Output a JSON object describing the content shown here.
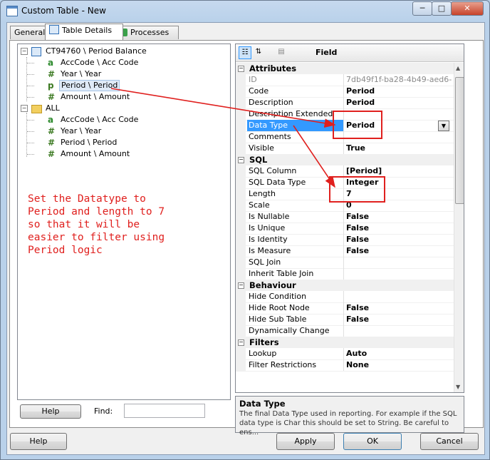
{
  "window": {
    "title": "Custom Table - New",
    "controls": {
      "minimize": "─",
      "maximize": "□",
      "close": "✕"
    }
  },
  "tabs": [
    {
      "label": "General"
    },
    {
      "label": "Table Details"
    },
    {
      "label": "Processes"
    }
  ],
  "tree": {
    "roots": [
      {
        "label": "CT94760 \\ Period Balance",
        "icon": "table-icon",
        "children": [
          {
            "label": "AccCode \\ Acc Code",
            "icon": "text-field-icon"
          },
          {
            "label": "Year \\ Year",
            "icon": "numeric-field-icon"
          },
          {
            "label": "Period \\ Period",
            "icon": "period-field-icon"
          },
          {
            "label": "Amount \\ Amount",
            "icon": "numeric-field-icon"
          }
        ]
      },
      {
        "label": "ALL",
        "icon": "folder-icon",
        "children": [
          {
            "label": "AccCode \\ Acc Code",
            "icon": "text-field-icon"
          },
          {
            "label": "Year \\ Year",
            "icon": "numeric-field-icon"
          },
          {
            "label": "Period \\ Period",
            "icon": "numeric-field-icon"
          },
          {
            "label": "Amount \\ Amount",
            "icon": "numeric-field-icon"
          }
        ]
      }
    ]
  },
  "annotation": {
    "text": "Set the Datatype to\nPeriod and length to 7\nso that it will be\neasier to filter using\nPeriod logic",
    "color": "#e0201e"
  },
  "left_footer": {
    "help": "Help",
    "find_label": "Find:",
    "find_value": ""
  },
  "property_grid": {
    "header": "Field",
    "categories": [
      {
        "name": "Attributes",
        "rows": [
          {
            "name": "ID",
            "value": "7db49f1f-ba28-4b49-aed6-",
            "grey": true
          },
          {
            "name": "Code",
            "value": "Period"
          },
          {
            "name": "Description",
            "value": "Period"
          },
          {
            "name": "Description Extended",
            "value": ""
          },
          {
            "name": "Data Type",
            "value": "Period",
            "selected": true
          },
          {
            "name": "Comments",
            "value": ""
          },
          {
            "name": "Visible",
            "value": "True"
          }
        ]
      },
      {
        "name": "SQL",
        "rows": [
          {
            "name": "SQL Column",
            "value": "[Period]"
          },
          {
            "name": "SQL Data Type",
            "value": "Integer"
          },
          {
            "name": "Length",
            "value": "7"
          },
          {
            "name": "Scale",
            "value": "0"
          },
          {
            "name": "Is Nullable",
            "value": "False"
          },
          {
            "name": "Is Unique",
            "value": "False"
          },
          {
            "name": "Is Identity",
            "value": "False"
          },
          {
            "name": "Is Measure",
            "value": "False"
          },
          {
            "name": "SQL Join",
            "value": ""
          },
          {
            "name": "Inherit Table Join",
            "value": ""
          }
        ]
      },
      {
        "name": "Behaviour",
        "rows": [
          {
            "name": "Hide Condition",
            "value": ""
          },
          {
            "name": "Hide Root Node",
            "value": "False"
          },
          {
            "name": "Hide Sub Table",
            "value": "False"
          },
          {
            "name": "Dynamically Change",
            "value": ""
          }
        ]
      },
      {
        "name": "Filters",
        "rows": [
          {
            "name": "Lookup",
            "value": "Auto"
          },
          {
            "name": "Filter Restrictions",
            "value": "None"
          }
        ]
      }
    ]
  },
  "description": {
    "title": "Data Type",
    "text": "The final Data Type used in reporting.  For example if the SQL data type is Char this should be set to String.  Be careful to ens..."
  },
  "footer": {
    "help": "Help",
    "apply": "Apply",
    "ok": "OK",
    "cancel": "Cancel"
  }
}
